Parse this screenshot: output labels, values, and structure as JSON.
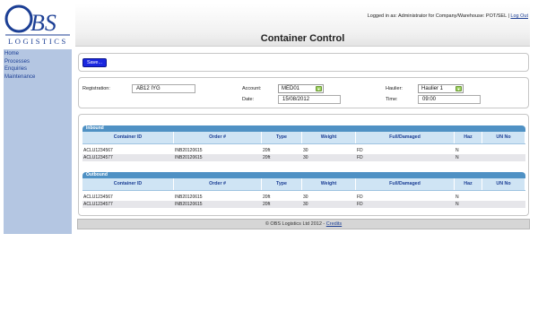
{
  "logo": {
    "mark": "OBS",
    "wordmark": "LOGISTICS"
  },
  "sidebar": {
    "items": [
      {
        "label": "Home"
      },
      {
        "label": "Processes"
      },
      {
        "label": "Enquiries"
      },
      {
        "label": "Maintenance"
      }
    ]
  },
  "header": {
    "login_text": "Logged in as: Administrator for Company/Warehouse: POT/SEL |",
    "logout_label": "Log Out",
    "title": "Container Control"
  },
  "toolbar": {
    "save_label": "Save..."
  },
  "form": {
    "registration": {
      "label": "Registration:",
      "value": "AB12 IYG"
    },
    "account": {
      "label": "Account:",
      "value": "MED01"
    },
    "haulier": {
      "label": "Haulier:",
      "value": "Haulier 1"
    },
    "date": {
      "label": "Date:",
      "value": "15/08/2012"
    },
    "time": {
      "label": "Time:",
      "value": "09:00"
    }
  },
  "columns": [
    "Container ID",
    "Order #",
    "Type",
    "Weight",
    "Full/Damaged",
    "Haz",
    "UN No"
  ],
  "inbound": {
    "title": "Inbound",
    "rows": [
      [
        "ACLU1234567",
        "INB20120615",
        "20ft",
        "30",
        "FD",
        "N",
        ""
      ],
      [
        "ACLU1234577",
        "INB20120615",
        "20ft",
        "30",
        "FD",
        "N",
        ""
      ]
    ]
  },
  "outbound": {
    "title": "Outbound",
    "rows": [
      [
        "ACLU1234567",
        "INB20120615",
        "20ft",
        "30",
        "FD",
        "N",
        ""
      ],
      [
        "ACLU1234577",
        "INB20120615",
        "20ft",
        "30",
        "FD",
        "N",
        ""
      ]
    ]
  },
  "footer": {
    "text": "© OBS Logistics Ltd 2012 -",
    "credits_label": "Credits"
  },
  "colors": {
    "sidebar": "#b4c6e2",
    "brand_blue": "#1c3f95",
    "save_button": "#1a27e0",
    "grid_title": "#4f91c4",
    "grid_header": "#cfe4f4"
  }
}
